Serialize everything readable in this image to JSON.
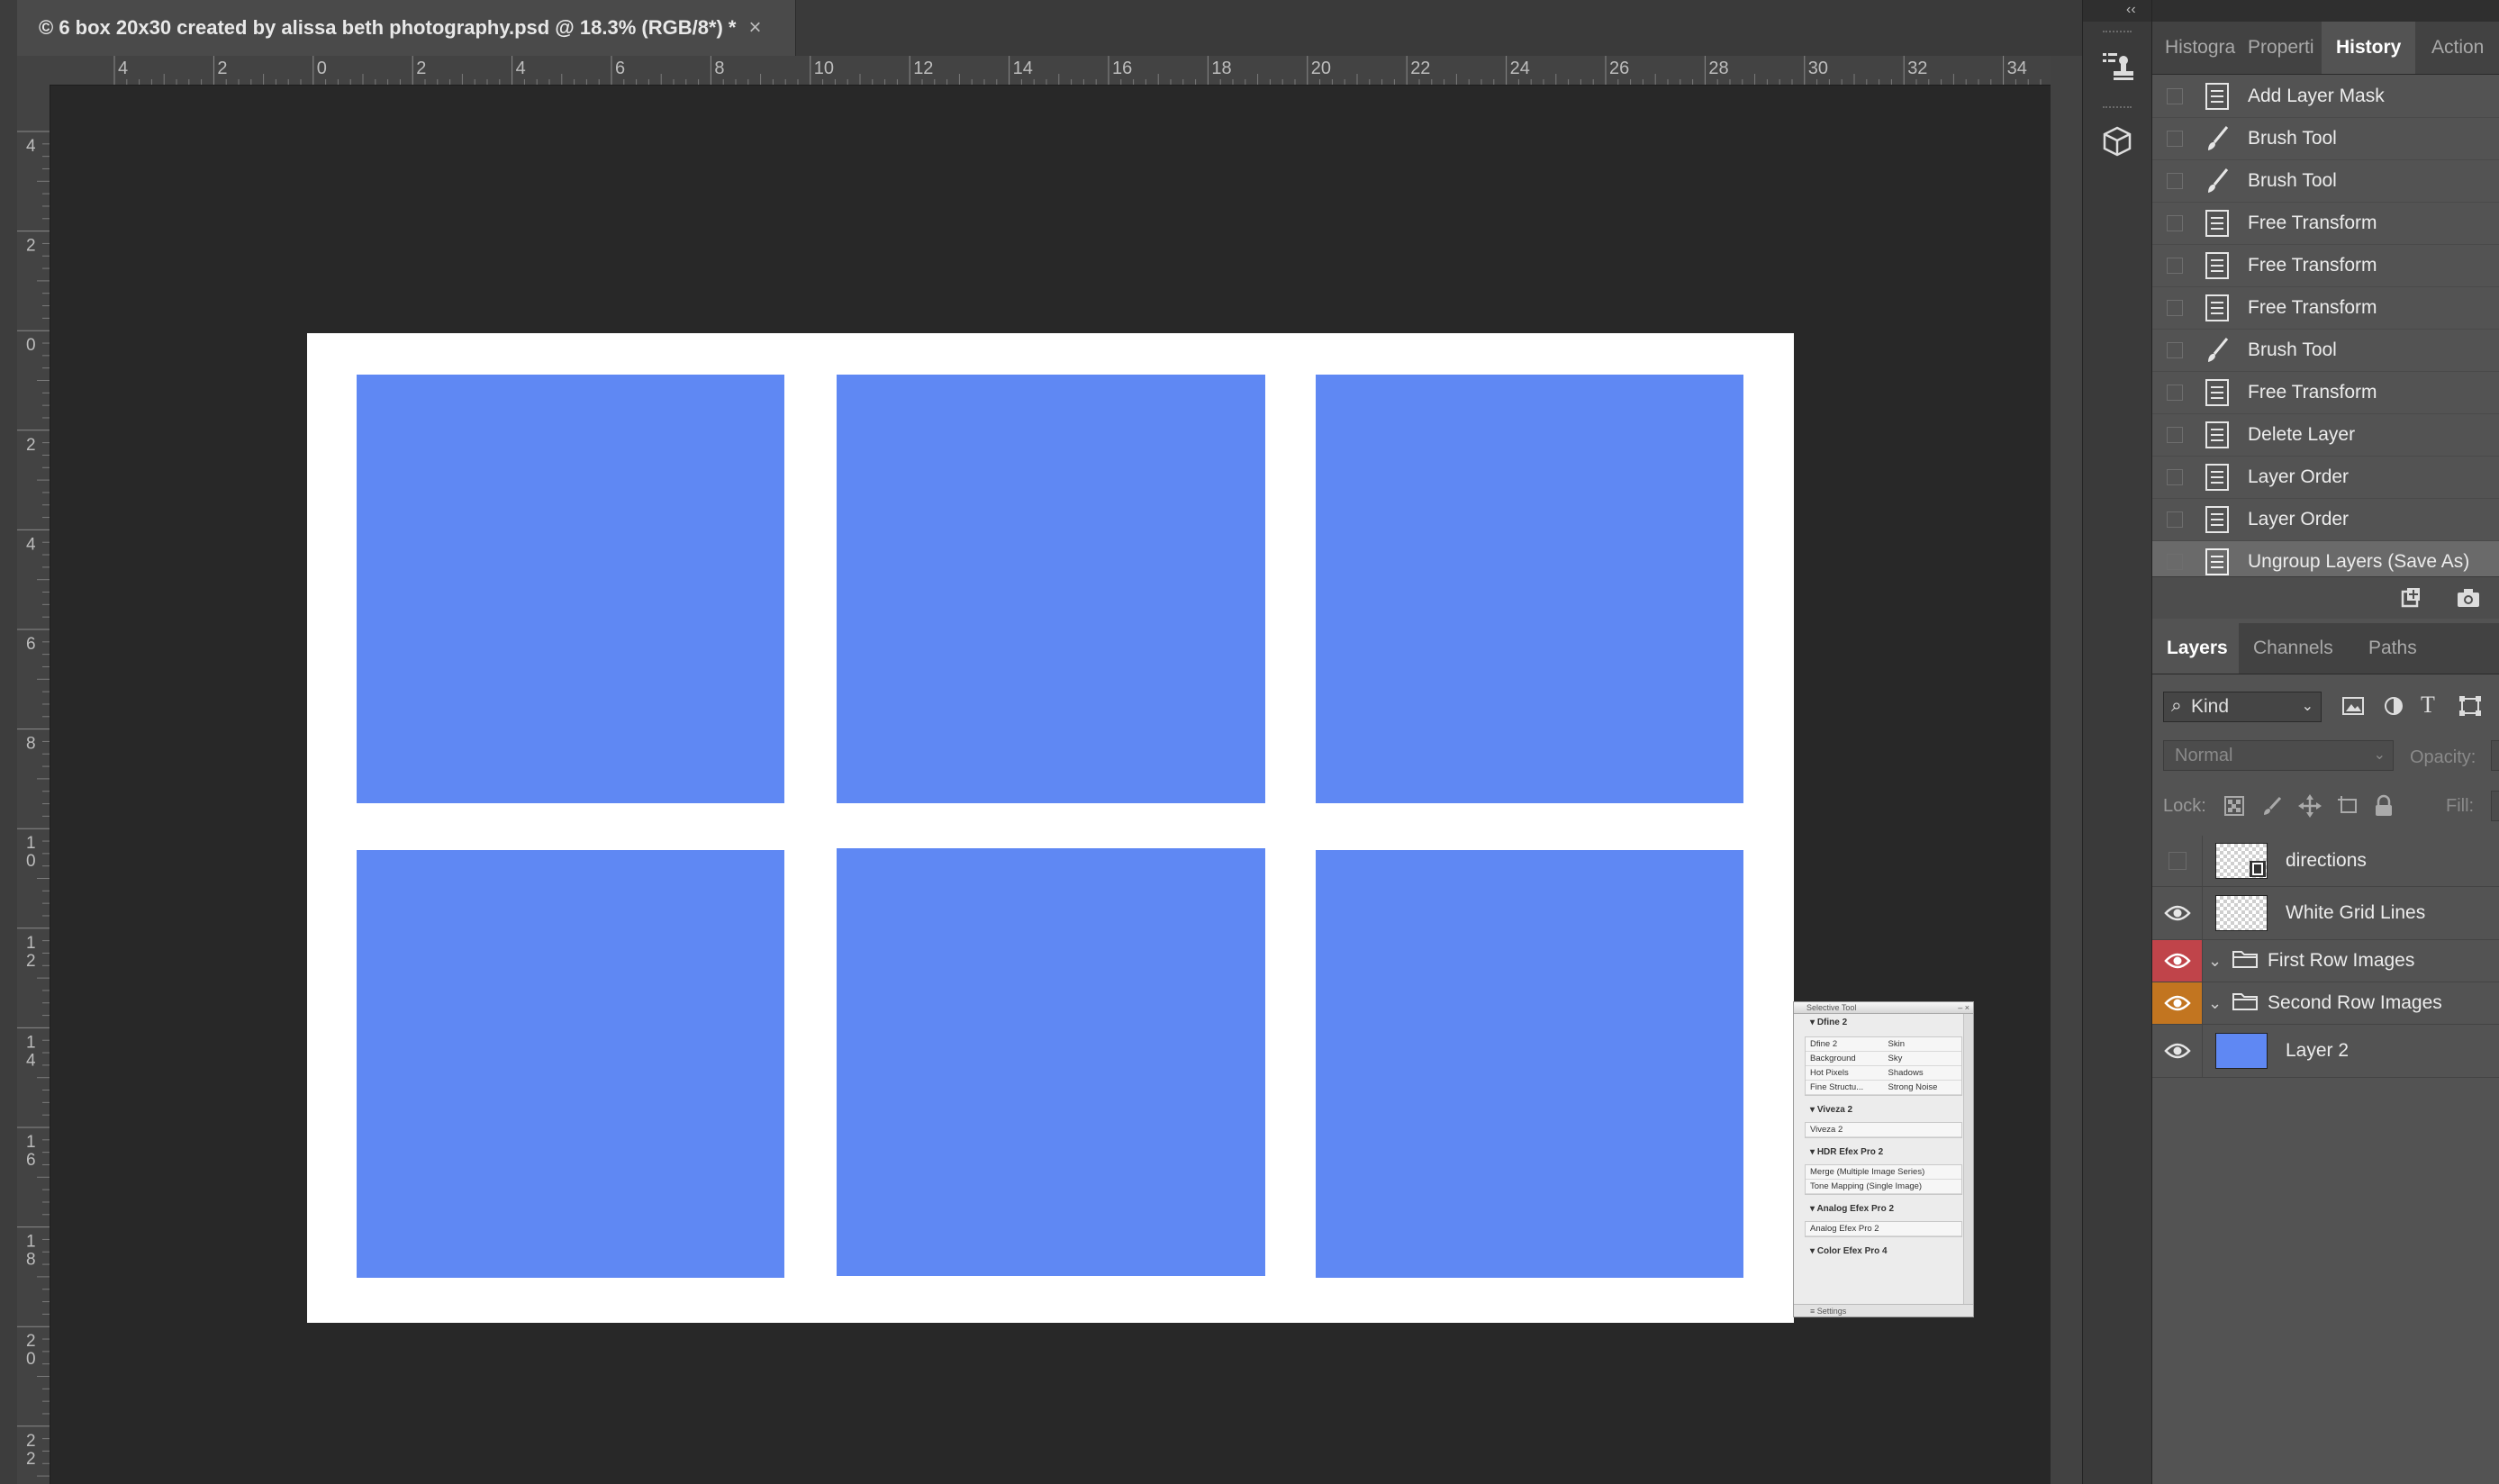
{
  "document": {
    "tab_title": "© 6 box 20x30  created by alissa beth photography.psd @ 18.3% (RGB/8*) *",
    "close_glyph": "×",
    "ruler_h_labels": [
      "4",
      "2",
      "0",
      "2",
      "4",
      "6",
      "8",
      "10",
      "12",
      "14",
      "16",
      "18",
      "20",
      "22",
      "24",
      "26",
      "28",
      "30",
      "32",
      "34"
    ],
    "ruler_v_labels": [
      "4",
      "2",
      "0",
      "2",
      "4",
      "6",
      "8",
      "1 0",
      "1 2",
      "1 4",
      "1 6",
      "1 8",
      "2 0",
      "2 2"
    ],
    "artboard_color": "#ffffff",
    "cell_color": "#5f88f3",
    "canvas_bg": "#282828"
  },
  "selective_tool": {
    "title": "Selective Tool",
    "sections": [
      {
        "name": "Dfine 2",
        "grid": [
          "Dfine 2",
          "Skin",
          "Background",
          "Sky",
          "Hot Pixels",
          "Shadows",
          "Fine Structu...",
          "Strong Noise"
        ]
      },
      {
        "name": "Viveza 2",
        "list": [
          "Viveza 2"
        ]
      },
      {
        "name": "HDR Efex Pro 2",
        "list": [
          "Merge (Multiple Image Series)",
          "Tone Mapping (Single Image)"
        ]
      },
      {
        "name": "Analog Efex Pro 2",
        "list": [
          "Analog Efex Pro 2"
        ]
      },
      {
        "name": "Color Efex Pro 4",
        "list": []
      }
    ],
    "footer": "Settings"
  },
  "dock": {
    "collapse_glyph": "‹‹",
    "icons": [
      "clone-source-icon",
      "3d-cube-icon"
    ]
  },
  "history_panel": {
    "tabs": [
      "Histogra",
      "Properti",
      "History",
      "Action"
    ],
    "active_tab": "History",
    "items": [
      {
        "label": "Add Layer Mask",
        "icon": "document-icon"
      },
      {
        "label": "Brush Tool",
        "icon": "brush-icon"
      },
      {
        "label": "Brush Tool",
        "icon": "brush-icon"
      },
      {
        "label": "Free Transform",
        "icon": "document-icon"
      },
      {
        "label": "Free Transform",
        "icon": "document-icon"
      },
      {
        "label": "Free Transform",
        "icon": "document-icon"
      },
      {
        "label": "Brush Tool",
        "icon": "brush-icon"
      },
      {
        "label": "Free Transform",
        "icon": "document-icon"
      },
      {
        "label": "Delete Layer",
        "icon": "document-icon"
      },
      {
        "label": "Layer Order",
        "icon": "document-icon"
      },
      {
        "label": "Layer Order",
        "icon": "document-icon"
      },
      {
        "label": "Ungroup Layers (Save As)",
        "icon": "document-icon",
        "selected": true
      }
    ]
  },
  "layers_panel": {
    "tabs": [
      "Layers",
      "Channels",
      "Paths"
    ],
    "active_tab": "Layers",
    "filter_kind": "Kind",
    "blend_mode": "Normal",
    "opacity_label": "Opacity:",
    "lock_label": "Lock:",
    "fill_label": "Fill:",
    "layers": [
      {
        "name": "directions",
        "visible": false,
        "type": "smart",
        "tag_color": ""
      },
      {
        "name": "White Grid Lines",
        "visible": true,
        "type": "pixel",
        "tag_color": ""
      },
      {
        "name": "First Row Images",
        "visible": true,
        "type": "group",
        "tag_color": "#c0444a"
      },
      {
        "name": "Second Row Images",
        "visible": true,
        "type": "group",
        "tag_color": "#c27520"
      },
      {
        "name": "Layer 2",
        "visible": true,
        "type": "fill",
        "tag_color": "",
        "swatch": "#5f88f3"
      }
    ]
  }
}
